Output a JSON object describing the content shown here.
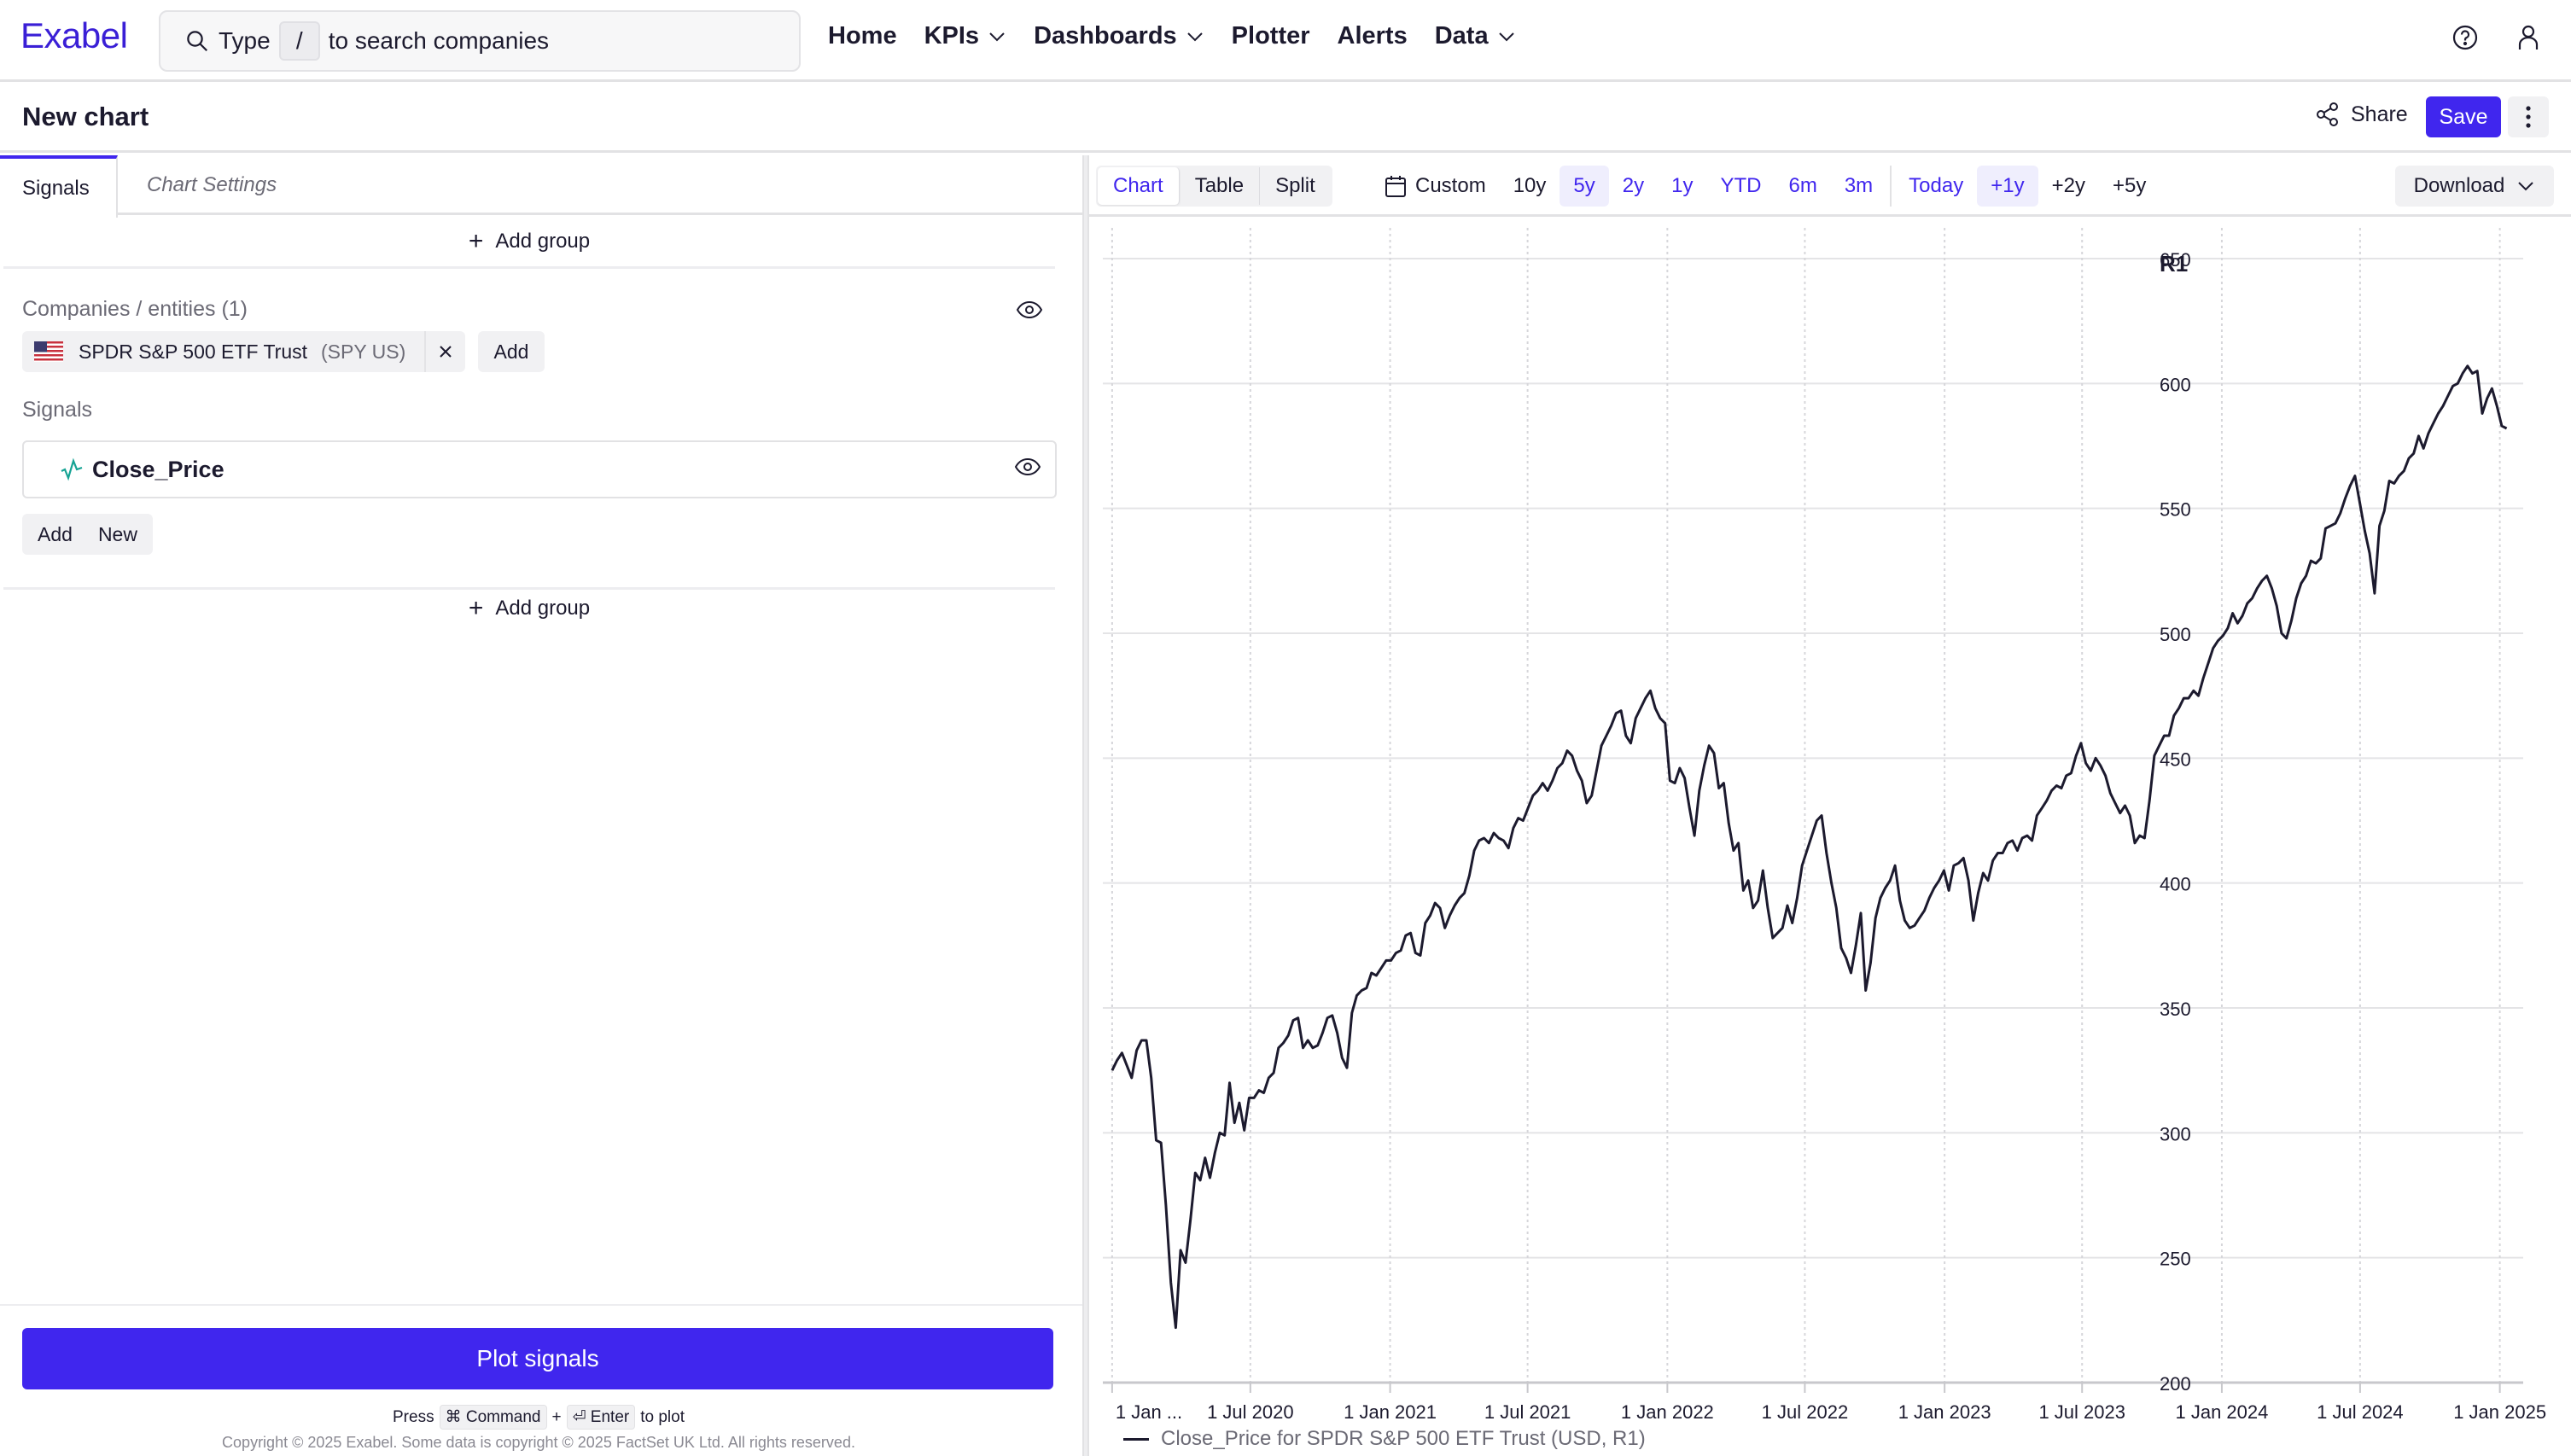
{
  "app": {
    "logo": "Exabel",
    "search": {
      "prefix": "Type",
      "shortcut": "/",
      "suffix": "to search companies"
    },
    "nav": [
      {
        "label": "Home",
        "has_dropdown": false
      },
      {
        "label": "KPIs",
        "has_dropdown": true
      },
      {
        "label": "Dashboards",
        "has_dropdown": true
      },
      {
        "label": "Plotter",
        "has_dropdown": false
      },
      {
        "label": "Alerts",
        "has_dropdown": false
      },
      {
        "label": "Data",
        "has_dropdown": true
      }
    ],
    "icons": {
      "help": "help-circle-icon",
      "user": "user-icon"
    },
    "accent_color": "#4026ee"
  },
  "header": {
    "title": "New chart",
    "share_label": "Share",
    "save_label": "Save"
  },
  "left_panel": {
    "tabs": [
      {
        "label": "Signals",
        "active": true
      },
      {
        "label": "Chart Settings",
        "active": false
      }
    ],
    "add_group_label": "Add group",
    "companies_label": "Companies / entities (1)",
    "entity": {
      "name": "SPDR S&P 500 ETF Trust",
      "ticker": "(SPY US)",
      "flag": "us-flag-icon"
    },
    "entity_add_label": "Add",
    "signals_label": "Signals",
    "signal": {
      "name": "Close_Price"
    },
    "signal_add_label": "Add",
    "signal_new_label": "New",
    "plot_button_label": "Plot signals",
    "hint": {
      "press": "Press",
      "key1": "⌘ Command",
      "plus": "+",
      "key2": "⏎ Enter",
      "suffix": "to plot"
    },
    "copyright": "Copyright © 2025 Exabel. Some data is copyright © 2025 FactSet UK Ltd. All rights reserved."
  },
  "chart_panel": {
    "views": [
      {
        "label": "Chart",
        "active": true
      },
      {
        "label": "Table",
        "active": false
      },
      {
        "label": "Split",
        "active": false
      }
    ],
    "ranges": [
      {
        "label": "Custom",
        "icon": true,
        "style": "dark"
      },
      {
        "label": "10y",
        "style": "dark"
      },
      {
        "label": "5y",
        "style": "active"
      },
      {
        "label": "2y",
        "style": "blue"
      },
      {
        "label": "1y",
        "style": "blue"
      },
      {
        "label": "YTD",
        "style": "blue"
      },
      {
        "label": "6m",
        "style": "blue"
      },
      {
        "label": "3m",
        "style": "blue"
      }
    ],
    "future_ranges": [
      {
        "label": "Today",
        "style": "blue"
      },
      {
        "label": "+1y",
        "style": "active"
      },
      {
        "label": "+2y",
        "style": "dark"
      },
      {
        "label": "+5y",
        "style": "dark"
      }
    ],
    "download_label": "Download"
  },
  "chart_data": {
    "type": "line",
    "title": "",
    "xlabel": "",
    "ylabel": "",
    "axis_label_right": "R1",
    "x_start": "2020-01-01",
    "x_end": "2025-01-10",
    "xlim": [
      "2019-12-31",
      "2025-02-12"
    ],
    "ylim": [
      200,
      650
    ],
    "y_ticks": [
      200,
      250,
      300,
      350,
      400,
      450,
      500,
      550,
      600,
      650
    ],
    "x_ticks": [
      {
        "date": "2020-01-01",
        "label": "1 Jan ..."
      },
      {
        "date": "2020-07-01",
        "label": "1 Jul 2020"
      },
      {
        "date": "2021-01-01",
        "label": "1 Jan 2021"
      },
      {
        "date": "2021-07-01",
        "label": "1 Jul 2021"
      },
      {
        "date": "2022-01-01",
        "label": "1 Jan 2022"
      },
      {
        "date": "2022-07-01",
        "label": "1 Jul 2022"
      },
      {
        "date": "2023-01-01",
        "label": "1 Jan 2023"
      },
      {
        "date": "2023-07-01",
        "label": "1 Jul 2023"
      },
      {
        "date": "2024-01-01",
        "label": "1 Jan 2024"
      },
      {
        "date": "2024-07-01",
        "label": "1 Jul 2024"
      },
      {
        "date": "2025-01-01",
        "label": "1 Jan 2025"
      }
    ],
    "grid": true,
    "legend_position": "bottom-left",
    "series": [
      {
        "name": "Close_Price for SPDR S&P 500 ETF Trust (USD, R1)",
        "color": "#1c1a2e",
        "frequency": "weekly",
        "values": [
          325,
          329,
          332,
          327,
          322,
          333,
          337,
          337,
          322,
          297,
          296,
          271,
          240,
          222,
          253,
          248,
          265,
          284,
          281,
          290,
          282,
          292,
          300,
          299,
          320,
          304,
          312,
          301,
          314,
          314,
          317,
          316,
          322,
          324,
          334,
          336,
          339,
          345,
          346,
          334,
          337,
          334,
          335,
          340,
          346,
          347,
          340,
          330,
          326,
          348,
          355,
          357,
          358,
          364,
          363,
          366,
          369,
          369,
          372,
          373,
          379,
          380,
          372,
          371,
          384,
          387,
          392,
          390,
          382,
          387,
          391,
          394,
          396,
          403,
          413,
          417,
          418,
          416,
          420,
          418,
          417,
          414,
          422,
          426,
          425,
          430,
          435,
          437,
          440,
          437,
          441,
          446,
          448,
          453,
          451,
          445,
          441,
          432,
          435,
          445,
          455,
          459,
          463,
          468,
          469,
          459,
          456,
          466,
          470,
          474,
          477,
          470,
          466,
          464,
          441,
          440,
          446,
          442,
          430,
          419,
          437,
          447,
          455,
          452,
          438,
          440,
          424,
          413,
          416,
          397,
          401,
          390,
          393,
          405,
          390,
          378,
          380,
          382,
          391,
          384,
          394,
          407,
          413,
          419,
          425,
          427,
          412,
          400,
          390,
          374,
          370,
          364,
          375,
          388,
          357,
          368,
          386,
          394,
          398,
          401,
          407,
          393,
          385,
          382,
          383,
          386,
          389,
          394,
          398,
          401,
          405,
          397,
          407,
          408,
          410,
          401,
          385,
          396,
          404,
          401,
          409,
          412,
          412,
          416,
          417,
          413,
          418,
          419,
          417,
          427,
          430,
          433,
          437,
          439,
          438,
          443,
          444,
          451,
          456,
          448,
          445,
          450,
          447,
          443,
          436,
          432,
          428,
          431,
          427,
          416,
          419,
          418,
          433,
          451,
          455,
          459,
          459,
          467,
          470,
          474,
          474,
          477,
          475,
          482,
          488,
          494,
          497,
          499,
          502,
          508,
          504,
          507,
          512,
          514,
          518,
          521,
          523,
          518,
          511,
          500,
          498,
          505,
          514,
          520,
          523,
          529,
          528,
          530,
          542,
          543,
          544,
          548,
          554,
          559,
          563,
          552,
          541,
          532,
          516,
          543,
          549,
          561,
          560,
          563,
          565,
          570,
          572,
          579,
          574,
          580,
          584,
          588,
          591,
          595,
          599,
          600,
          604,
          607,
          604,
          605,
          588,
          594,
          598,
          591,
          583,
          582
        ]
      }
    ]
  }
}
